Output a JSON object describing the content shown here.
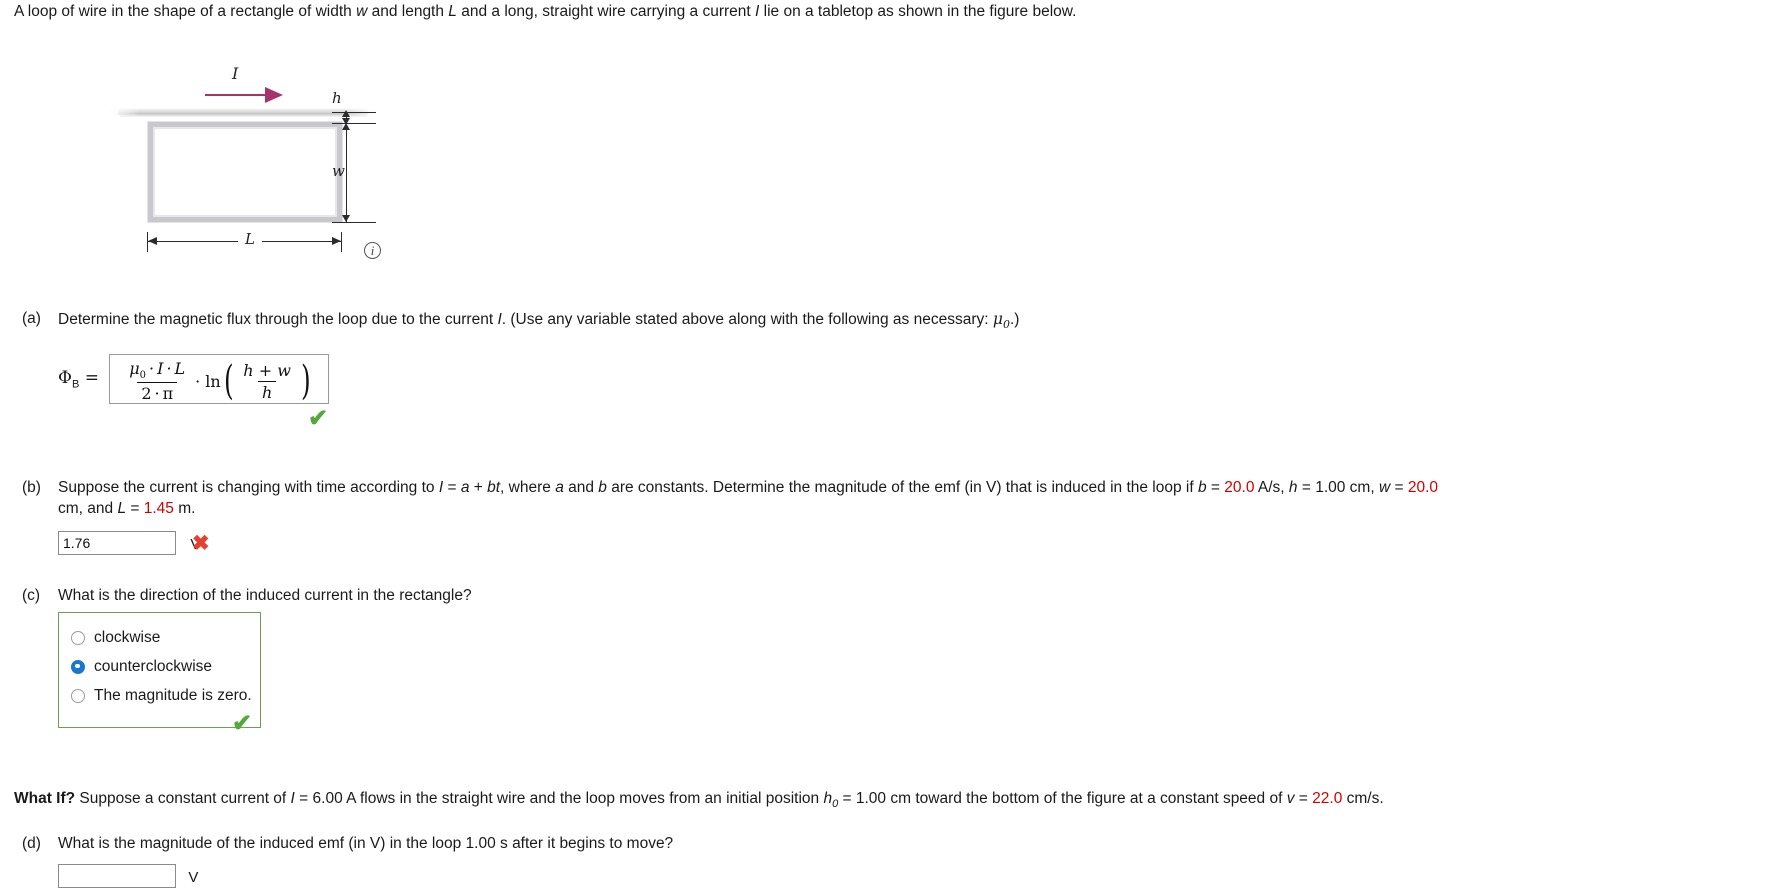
{
  "prompt": {
    "text_part1": "A loop of wire in the shape of a rectangle of width ",
    "var_w": "w",
    "text_part2": " and length ",
    "var_L": "L",
    "text_part3": " and a long, straight wire carrying a current ",
    "var_I": "I",
    "text_part4": " lie on a tabletop as shown in the figure below."
  },
  "figure": {
    "current_label": "I",
    "h_label": "h",
    "w_label": "w",
    "L_label": "L",
    "info_icon_glyph": "i",
    "arrow_color": "#a8336a",
    "wire_color": "#c9c9cd"
  },
  "parts": {
    "a": {
      "tag": "(a)",
      "text1": "Determine the magnetic flux through the loop due to the current ",
      "var_I": "I",
      "text2": ". (Use any variable stated above along with the following as necessary: ",
      "mu_symbol": "μ",
      "mu_sub": "0",
      "text3": ".)",
      "answer_label": "Φ",
      "answer_label_sub": "B",
      "equals": "=",
      "formula": {
        "numerator": "μ₀ · I · L",
        "denominator": "2 · π",
        "dot": "·",
        "ln": "ln",
        "inner_numerator": "h + w",
        "inner_denominator": "h",
        "mu": "μ",
        "mu_sub": "0",
        "I": "I",
        "L": "L",
        "two": "2",
        "pi": "π",
        "h": "h",
        "w": "w",
        "plus": "+"
      },
      "status": "correct",
      "status_glyph": "✔"
    },
    "b": {
      "tag": "(b)",
      "text1": "Suppose the current is changing with time according to ",
      "var_I": "I",
      "eq1": " = ",
      "var_a": "a",
      "plus": " + ",
      "var_bt": "bt",
      "text2": ", where ",
      "var_a2": "a",
      "text3": " and ",
      "var_b2": "b",
      "text4": " are constants. Determine the magnitude of the emf (in V) that is induced in the loop if ",
      "var_b3": "b",
      "val_b": "20.0",
      "unit_b": " A/s, ",
      "var_h": "h",
      "val_h": "1.00 cm",
      "comma1": ", ",
      "var_w": "w",
      "val_w": "20.0",
      "line2_prefix": "cm, and ",
      "var_L": "L",
      "val_L": "1.45",
      "line2_suffix": " m.",
      "input_value": "1.76",
      "unit": "V",
      "status": "incorrect",
      "status_glyph": "✖"
    },
    "c": {
      "tag": "(c)",
      "question": "What is the direction of the induced current in the rectangle?",
      "options": [
        {
          "label": "clockwise",
          "selected": false
        },
        {
          "label": "counterclockwise",
          "selected": true
        },
        {
          "label": "The magnitude is zero.",
          "selected": false
        }
      ],
      "status": "correct",
      "status_glyph": "✔"
    },
    "whatif": {
      "prefix": "What If?",
      "text1": " Suppose a constant current of ",
      "var_I": "I",
      "val_I": " = 6.00 A",
      "text2": " flows in the straight wire and the loop moves from an initial position ",
      "var_h0": "h",
      "var_h0_sub": "0",
      "val_h0": " = 1.00 cm",
      "text3": " toward the bottom of the figure at a constant speed of ",
      "var_v": "v",
      "eq": " = ",
      "val_v": "22.0",
      "unit_v": " cm/s."
    },
    "d": {
      "tag": "(d)",
      "question": "What is the magnitude of the induced emf (in V) in the loop 1.00 s after it begins to move?",
      "input_value": "",
      "placeholder": "",
      "unit": "V"
    }
  }
}
